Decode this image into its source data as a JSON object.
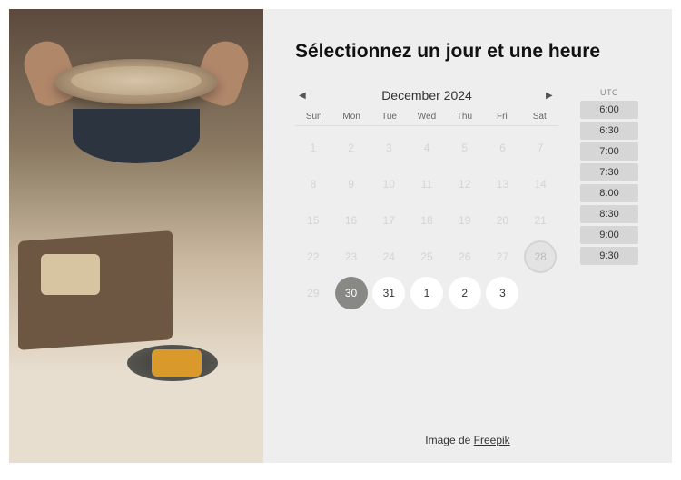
{
  "title": "Sélectionnez un jour et une heure",
  "calendar": {
    "month_label": "December  2024",
    "weekdays": [
      "Sun",
      "Mon",
      "Tue",
      "Wed",
      "Thu",
      "Fri",
      "Sat"
    ],
    "weeks": [
      [
        {
          "n": "1",
          "state": "faded"
        },
        {
          "n": "2",
          "state": "faded"
        },
        {
          "n": "3",
          "state": "faded"
        },
        {
          "n": "4",
          "state": "faded"
        },
        {
          "n": "5",
          "state": "faded"
        },
        {
          "n": "6",
          "state": "faded"
        },
        {
          "n": "7",
          "state": "faded"
        }
      ],
      [
        {
          "n": "8",
          "state": "faded"
        },
        {
          "n": "9",
          "state": "faded"
        },
        {
          "n": "10",
          "state": "faded"
        },
        {
          "n": "11",
          "state": "faded"
        },
        {
          "n": "12",
          "state": "faded"
        },
        {
          "n": "13",
          "state": "faded"
        },
        {
          "n": "14",
          "state": "faded"
        }
      ],
      [
        {
          "n": "15",
          "state": "faded"
        },
        {
          "n": "16",
          "state": "faded"
        },
        {
          "n": "17",
          "state": "faded"
        },
        {
          "n": "18",
          "state": "faded"
        },
        {
          "n": "19",
          "state": "faded"
        },
        {
          "n": "20",
          "state": "faded"
        },
        {
          "n": "21",
          "state": "faded"
        }
      ],
      [
        {
          "n": "22",
          "state": "faded"
        },
        {
          "n": "23",
          "state": "faded"
        },
        {
          "n": "24",
          "state": "faded"
        },
        {
          "n": "25",
          "state": "faded"
        },
        {
          "n": "26",
          "state": "faded"
        },
        {
          "n": "27",
          "state": "faded"
        },
        {
          "n": "28",
          "state": "ring"
        }
      ],
      [
        {
          "n": "29",
          "state": "faded"
        },
        {
          "n": "30",
          "state": "selected"
        },
        {
          "n": "31",
          "state": "avail"
        },
        {
          "n": "1",
          "state": "avail"
        },
        {
          "n": "2",
          "state": "avail"
        },
        {
          "n": "3",
          "state": "avail"
        },
        {
          "n": "",
          "state": "blank"
        }
      ]
    ]
  },
  "timezone": "UTC",
  "timeslots": [
    "6:00",
    "6:30",
    "7:00",
    "7:30",
    "8:00",
    "8:30",
    "9:00",
    "9:30"
  ],
  "credit": {
    "prefix": "Image de ",
    "link_text": "Freepik"
  }
}
